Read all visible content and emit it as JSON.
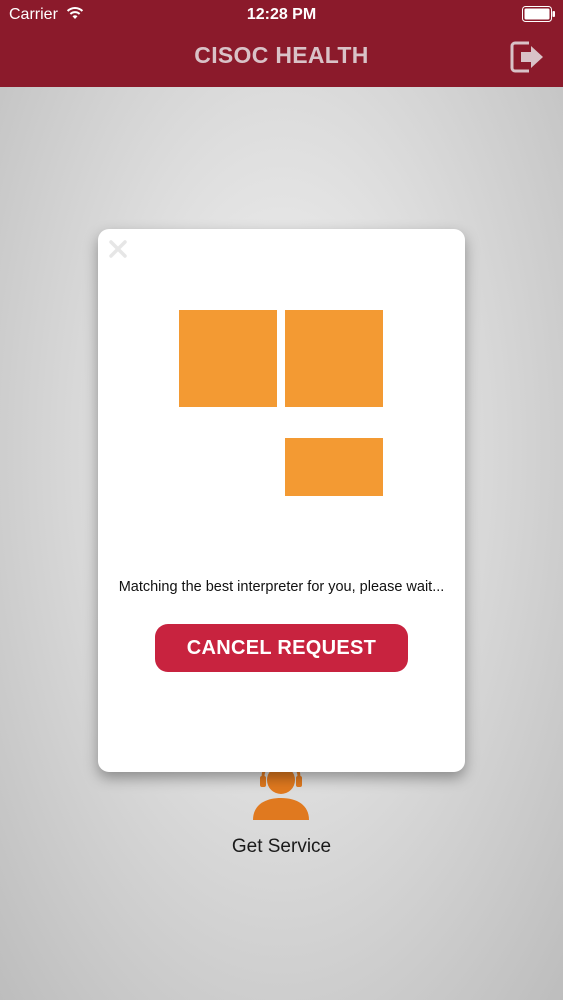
{
  "status_bar": {
    "carrier": "Carrier",
    "time": "12:28 PM",
    "wifi_icon": "wifi-icon",
    "battery_icon": "battery-icon"
  },
  "nav": {
    "title": "CISOC HEALTH",
    "logout_icon": "logout-icon"
  },
  "main": {
    "service_icon": "agent-headset-icon",
    "service_label": "Get Service"
  },
  "modal": {
    "close_icon": "close-icon",
    "message": "Matching the best interpreter for you, please wait...",
    "cancel_label": "CANCEL REQUEST"
  },
  "colors": {
    "header": "#8b1a2b",
    "accent_orange": "#f39a33",
    "button_red": "#c8233f"
  }
}
